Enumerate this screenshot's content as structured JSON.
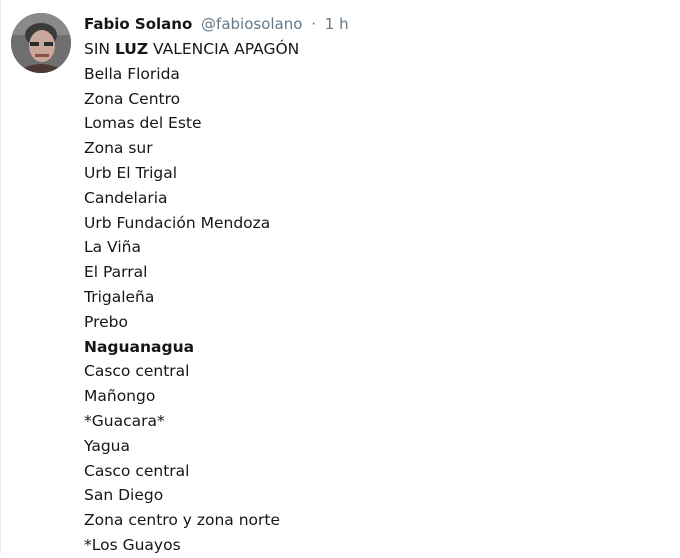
{
  "tweet": {
    "author_name": "Fabio Solano",
    "author_handle": "@fabiosolano",
    "separator": "·",
    "timestamp": "1 h",
    "title_parts": [
      "SIN ",
      "LUZ",
      " VALENCIA APAGÓN"
    ],
    "lines": [
      "Bella Florida",
      "Zona Centro",
      "Lomas del Este",
      "Zona sur",
      "Urb El Trigal",
      "Candelaria",
      "Urb Fundación Mendoza",
      "La Viña",
      "El Parral",
      "Trigaleña",
      "Prebo",
      "Naguanagua",
      "Casco central",
      "Mañongo",
      "*Guacara*",
      "Yagua",
      "Casco central",
      "San Diego",
      "Zona centro y zona norte",
      "*Los Guayos"
    ],
    "bold_line": "Naguanagua"
  },
  "colors": {
    "text": "#14171a",
    "muted": "#657786",
    "border": "#e6ecf0"
  }
}
